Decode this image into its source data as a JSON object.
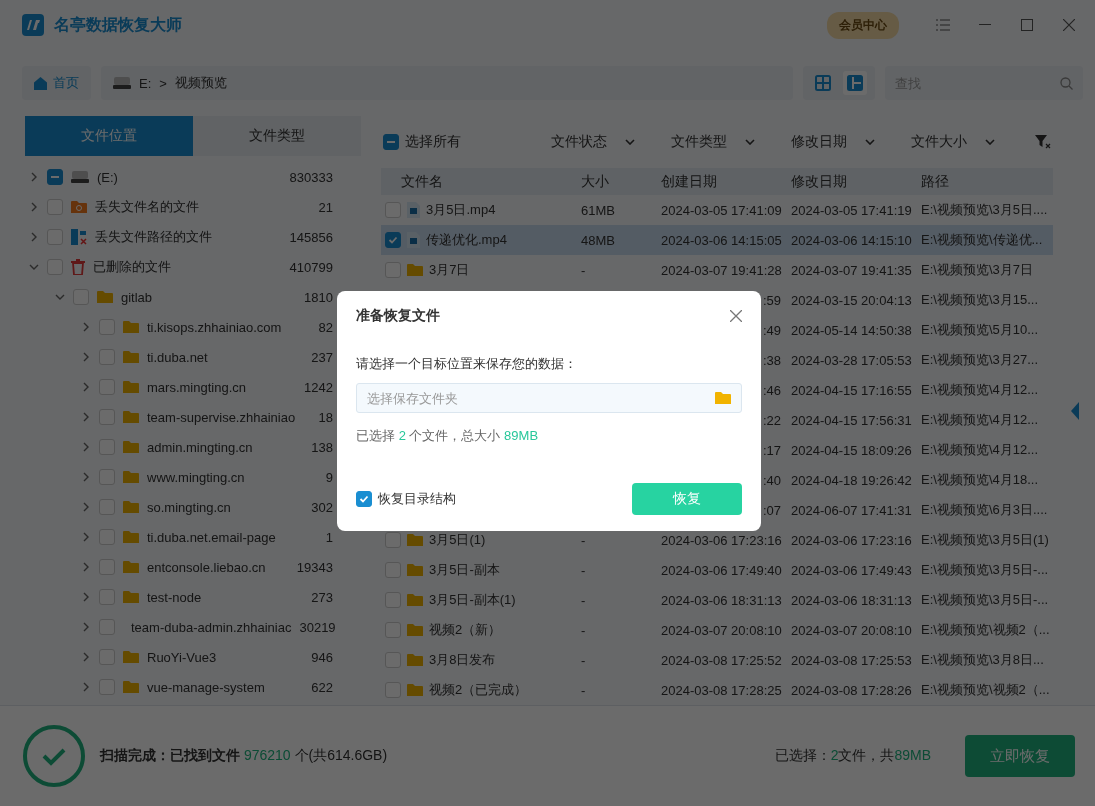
{
  "window": {
    "title": "名亭数据恢复大师",
    "member_button": "会员中心"
  },
  "nav": {
    "views": [
      {
        "kind": "grid",
        "selected": false
      },
      {
        "kind": "list",
        "selected": true
      }
    ],
    "home": "首页",
    "drive": "E:",
    "separator": ">",
    "folder": "视频预览",
    "search": {
      "placeholder": "查找"
    }
  },
  "side_tabs": [
    {
      "label": "文件位置",
      "selected": true
    },
    {
      "label": "文件类型",
      "selected": false
    }
  ],
  "tree": [
    {
      "kind": "drive",
      "label": "(E:)",
      "count": "830333",
      "expanded": false,
      "checked": false,
      "partial": true
    },
    {
      "kind": "lost-name",
      "label": "丢失文件名的文件",
      "count": "21",
      "expanded": false,
      "checked": false,
      "partial": false
    },
    {
      "kind": "lost-path",
      "label": "丢失文件路径的文件",
      "count": "145856",
      "expanded": false,
      "checked": false,
      "partial": false
    },
    {
      "kind": "trash",
      "label": "已删除的文件",
      "count": "410799",
      "expanded": true,
      "checked": false,
      "partial": false,
      "children": [
        {
          "kind": "folder",
          "label": "gitlab",
          "count": "1810",
          "expanded": true,
          "checked": false,
          "partial": false,
          "children": [
            {
              "kind": "folder",
              "label": "ti.kisops.zhhainiao.com",
              "count": "82",
              "expanded": false,
              "checked": false,
              "partial": false
            },
            {
              "kind": "folder",
              "label": "ti.duba.net",
              "count": "237",
              "expanded": false,
              "checked": false,
              "partial": false
            },
            {
              "kind": "folder",
              "label": "mars.mingting.cn",
              "count": "1242",
              "expanded": false,
              "checked": false,
              "partial": false
            },
            {
              "kind": "folder",
              "label": "team-supervise.zhhainiao",
              "count": "18",
              "expanded": false,
              "checked": false,
              "partial": false
            },
            {
              "kind": "folder",
              "label": "admin.mingting.cn",
              "count": "138",
              "expanded": false,
              "checked": false,
              "partial": false
            },
            {
              "kind": "folder",
              "label": "www.mingting.cn",
              "count": "9",
              "expanded": false,
              "checked": false,
              "partial": false
            },
            {
              "kind": "folder",
              "label": "so.mingting.cn",
              "count": "302",
              "expanded": false,
              "checked": false,
              "partial": false
            },
            {
              "kind": "folder",
              "label": "ti.duba.net.email-page",
              "count": "1",
              "expanded": false,
              "checked": false,
              "partial": false
            },
            {
              "kind": "folder",
              "label": "entconsole.liebao.cn",
              "count": "19343",
              "expanded": false,
              "checked": false,
              "partial": false
            },
            {
              "kind": "folder",
              "label": "test-node",
              "count": "273",
              "expanded": false,
              "checked": false,
              "partial": false
            },
            {
              "kind": "folder",
              "label": "team-duba-admin.zhhainiac",
              "count": "30219",
              "expanded": false,
              "checked": false,
              "partial": false
            },
            {
              "kind": "folder",
              "label": "RuoYi-Vue3",
              "count": "946",
              "expanded": false,
              "checked": false,
              "partial": false
            },
            {
              "kind": "folder",
              "label": "vue-manage-system",
              "count": "622",
              "expanded": false,
              "checked": false,
              "partial": false
            }
          ]
        }
      ]
    }
  ],
  "toolbar": {
    "select_all": {
      "label": "选择所有",
      "checked": false,
      "partial": true
    },
    "filters": [
      "文件状态",
      "文件类型",
      "修改日期",
      "文件大小"
    ]
  },
  "table": {
    "columns": [
      "文件名",
      "大小",
      "创建日期",
      "修改日期",
      "路径"
    ],
    "rows": [
      {
        "kind": "video",
        "name": "3月5日.mp4",
        "size": "61MB",
        "created": "2024-03-05 17:41:09",
        "modified": "2024-03-05 17:41:19",
        "path": "E:\\视频预览\\3月5日....",
        "checked": false,
        "selected": false
      },
      {
        "kind": "video",
        "name": "传递优化.mp4",
        "size": "48MB",
        "created": "2024-03-06 14:15:05",
        "modified": "2024-03-06 14:15:10",
        "path": "E:\\视频预览\\传递优...",
        "checked": true,
        "selected": true
      },
      {
        "kind": "folder",
        "name": "3月7日",
        "size": "-",
        "created": "2024-03-07 19:41:28",
        "modified": "2024-03-07 19:41:35",
        "path": "E:\\视频预览\\3月7日",
        "checked": false,
        "selected": false
      },
      {
        "kind": "hidden",
        "created": ":59",
        "modified": "2024-03-15 20:04:13",
        "path": "E:\\视频预览\\3月15..."
      },
      {
        "kind": "hidden",
        "created": ":49",
        "modified": "2024-05-14 14:50:38",
        "path": "E:\\视频预览\\5月10..."
      },
      {
        "kind": "hidden",
        "created": ":38",
        "modified": "2024-03-28 17:05:53",
        "path": "E:\\视频预览\\3月27..."
      },
      {
        "kind": "hidden",
        "created": ":46",
        "modified": "2024-04-15 17:16:55",
        "path": "E:\\视频预览\\4月12..."
      },
      {
        "kind": "hidden",
        "created": ":22",
        "modified": "2024-04-15 17:56:31",
        "path": "E:\\视频预览\\4月12..."
      },
      {
        "kind": "hidden",
        "created": ":17",
        "modified": "2024-04-15 18:09:26",
        "path": "E:\\视频预览\\4月12..."
      },
      {
        "kind": "hidden",
        "created": ":40",
        "modified": "2024-04-18 19:26:42",
        "path": "E:\\视频预览\\4月18..."
      },
      {
        "kind": "hidden",
        "created": ":07",
        "modified": "2024-06-07 17:41:31",
        "path": "E:\\视频预览\\6月3日...."
      },
      {
        "kind": "folder",
        "name": "3月5日(1)",
        "size": "-",
        "created": "2024-03-06 17:23:16",
        "modified": "2024-03-06 17:23:16",
        "path": "E:\\视频预览\\3月5日(1)",
        "checked": false,
        "selected": false
      },
      {
        "kind": "folder",
        "name": "3月5日-副本",
        "size": "-",
        "created": "2024-03-06 17:49:40",
        "modified": "2024-03-06 17:49:43",
        "path": "E:\\视频预览\\3月5日-...",
        "checked": false,
        "selected": false
      },
      {
        "kind": "folder",
        "name": "3月5日-副本(1)",
        "size": "-",
        "created": "2024-03-06 18:31:13",
        "modified": "2024-03-06 18:31:13",
        "path": "E:\\视频预览\\3月5日-...",
        "checked": false,
        "selected": false
      },
      {
        "kind": "folder",
        "name": "视频2（新）",
        "size": "-",
        "created": "2024-03-07 20:08:10",
        "modified": "2024-03-07 20:08:10",
        "path": "E:\\视频预览\\视频2（...",
        "checked": false,
        "selected": false
      },
      {
        "kind": "folder",
        "name": "3月8日发布",
        "size": "-",
        "created": "2024-03-08 17:25:52",
        "modified": "2024-03-08 17:25:53",
        "path": "E:\\视频预览\\3月8日...",
        "checked": false,
        "selected": false
      },
      {
        "kind": "folder",
        "name": "视频2（已完成）",
        "size": "-",
        "created": "2024-03-08 17:28:25",
        "modified": "2024-03-08 17:28:26",
        "path": "E:\\视频预览\\视频2（...",
        "checked": false,
        "selected": false
      }
    ]
  },
  "status_bar": {
    "label": "扫描完成：已找到文件",
    "count": "976210",
    "suffix": "个(共614.6GB)",
    "selected_label": "已选择：",
    "selected_count": "2",
    "selected_mid": "文件，共",
    "selected_size": "89MB",
    "button": "立即恢复"
  },
  "dialog": {
    "title": "准备恢复文件",
    "prompt": "请选择一个目标位置来保存您的数据：",
    "field": {
      "placeholder": "选择保存文件夹"
    },
    "summary_pre": "已选择",
    "summary_count": "2",
    "summary_mid": "个文件，总大小",
    "summary_size": "89MB",
    "keep_structure": {
      "label": "恢复目录结构",
      "checked": true
    },
    "button": "恢复"
  }
}
